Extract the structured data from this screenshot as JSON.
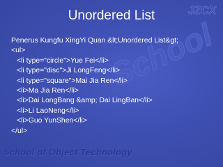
{
  "slide": {
    "title": "Unordered List",
    "logo_text": "JZCX",
    "watermark_text": "School",
    "footer_text": "School of Object Technology",
    "code_lines": [
      "Penerus Kungfu XingYi Quan &lt;Unordered List&gt;",
      "<ul>",
      "<li type=\"circle\">Yue Fei</li>",
      "<li type=\"disc\">Ji LongFeng</li>",
      "<li type=\"square\">Mai Jia Ren</li>",
      "<li>Ma Jia Ren</li>",
      "<li>Dai LongBang &amp; Dai LingBan</li>",
      "<li>Li LaoNeng</li>",
      "<li>Guo YunShen</li>",
      "</ul>"
    ]
  },
  "colors": {
    "background": "#3d4fae",
    "text": "#ffffff",
    "footer": "#2a3891",
    "watermark": "#5a6cd0"
  }
}
